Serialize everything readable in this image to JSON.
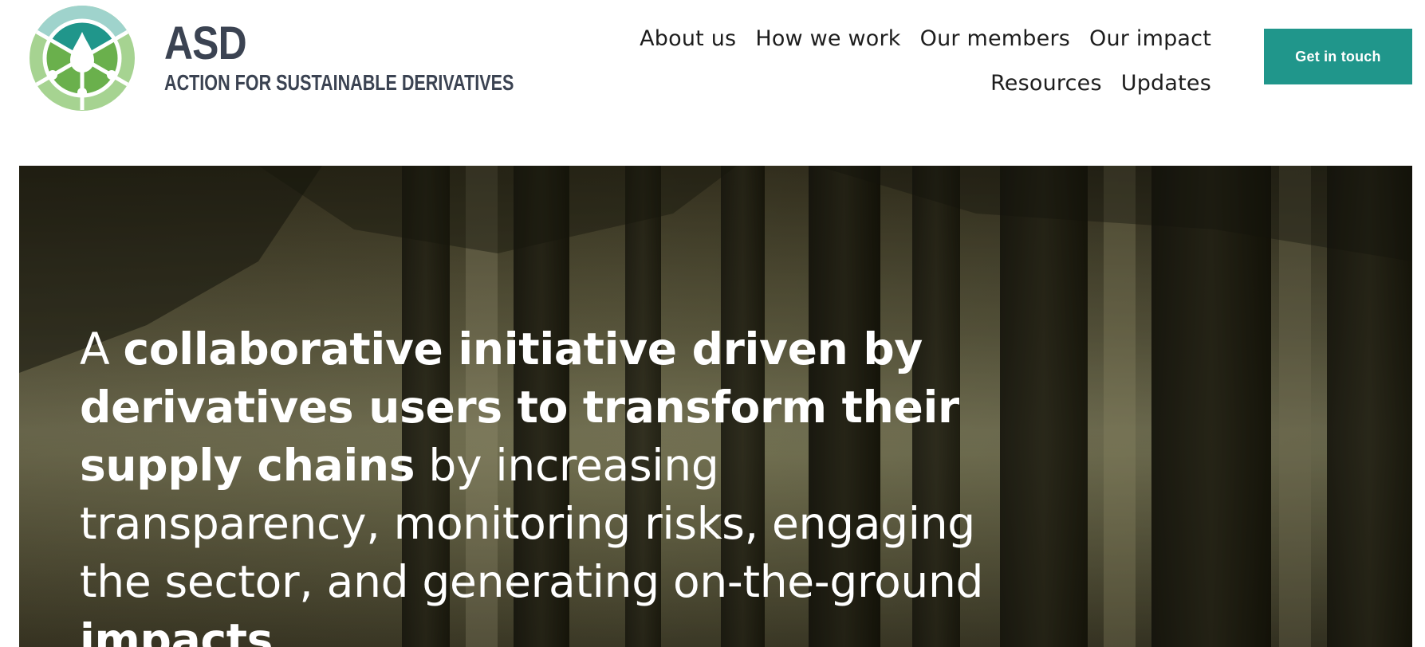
{
  "brand": {
    "short_name": "ASD",
    "full_name": "ACTION FOR SUSTAINABLE DERIVATIVES"
  },
  "nav": {
    "row1": [
      "About us",
      "How we work",
      "Our members",
      "Our impact"
    ],
    "row2": [
      "Resources",
      "Updates"
    ]
  },
  "cta": {
    "label": "Get in touch"
  },
  "hero": {
    "part1": "A ",
    "part2_bold": "collaborative initiative driven by derivatives users to transform their supply chains",
    "part3": " by increasing transparency, monitoring risks, engaging the sector, and generating on-the-ground ",
    "part4_bold": "impacts"
  },
  "colors": {
    "accent": "#20968b",
    "brand_text": "#3b4352",
    "logo_light_green": "#a6d391",
    "logo_green": "#6ab04c",
    "logo_teal": "#20968b",
    "logo_light_teal": "#9fd3cc"
  },
  "icons": {
    "logo": "leaf-drop-circle-logo"
  }
}
